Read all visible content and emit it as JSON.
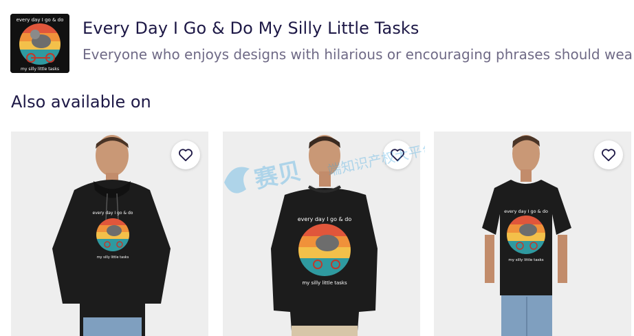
{
  "product": {
    "title": "Every Day I Go & Do My Silly Little Tasks",
    "description": "Everyone who enjoys designs with hilarious or encouraging phrases should wear this",
    "thumbnail_text_top": "every day I go & do",
    "thumbnail_text_bottom": "my silly little tasks"
  },
  "section": {
    "heading": "Also available on"
  },
  "cards": [
    {
      "product_type": "hoodie",
      "print_top": "every day I go & do",
      "print_bottom": "my silly little tasks"
    },
    {
      "product_type": "sweatshirt",
      "print_top": "every day I go & do",
      "print_bottom": "my silly little tasks"
    },
    {
      "product_type": "t-shirt",
      "print_top": "every day I go & do",
      "print_bottom": "my silly little tasks"
    }
  ],
  "watermark": {
    "text_big": "赛贝",
    "text_small": "端知识产权大平台"
  },
  "colors": {
    "title": "#1d1846",
    "subtitle": "#6f6a86",
    "card_bg": "#eeeeee",
    "garment": "#1c1c1c",
    "stripe_red": "#e0563b",
    "stripe_orange": "#f0913a",
    "stripe_yellow": "#f3c04a",
    "stripe_teal": "#2f9aa0"
  },
  "icons": {
    "favorite": "heart-outline-icon"
  }
}
